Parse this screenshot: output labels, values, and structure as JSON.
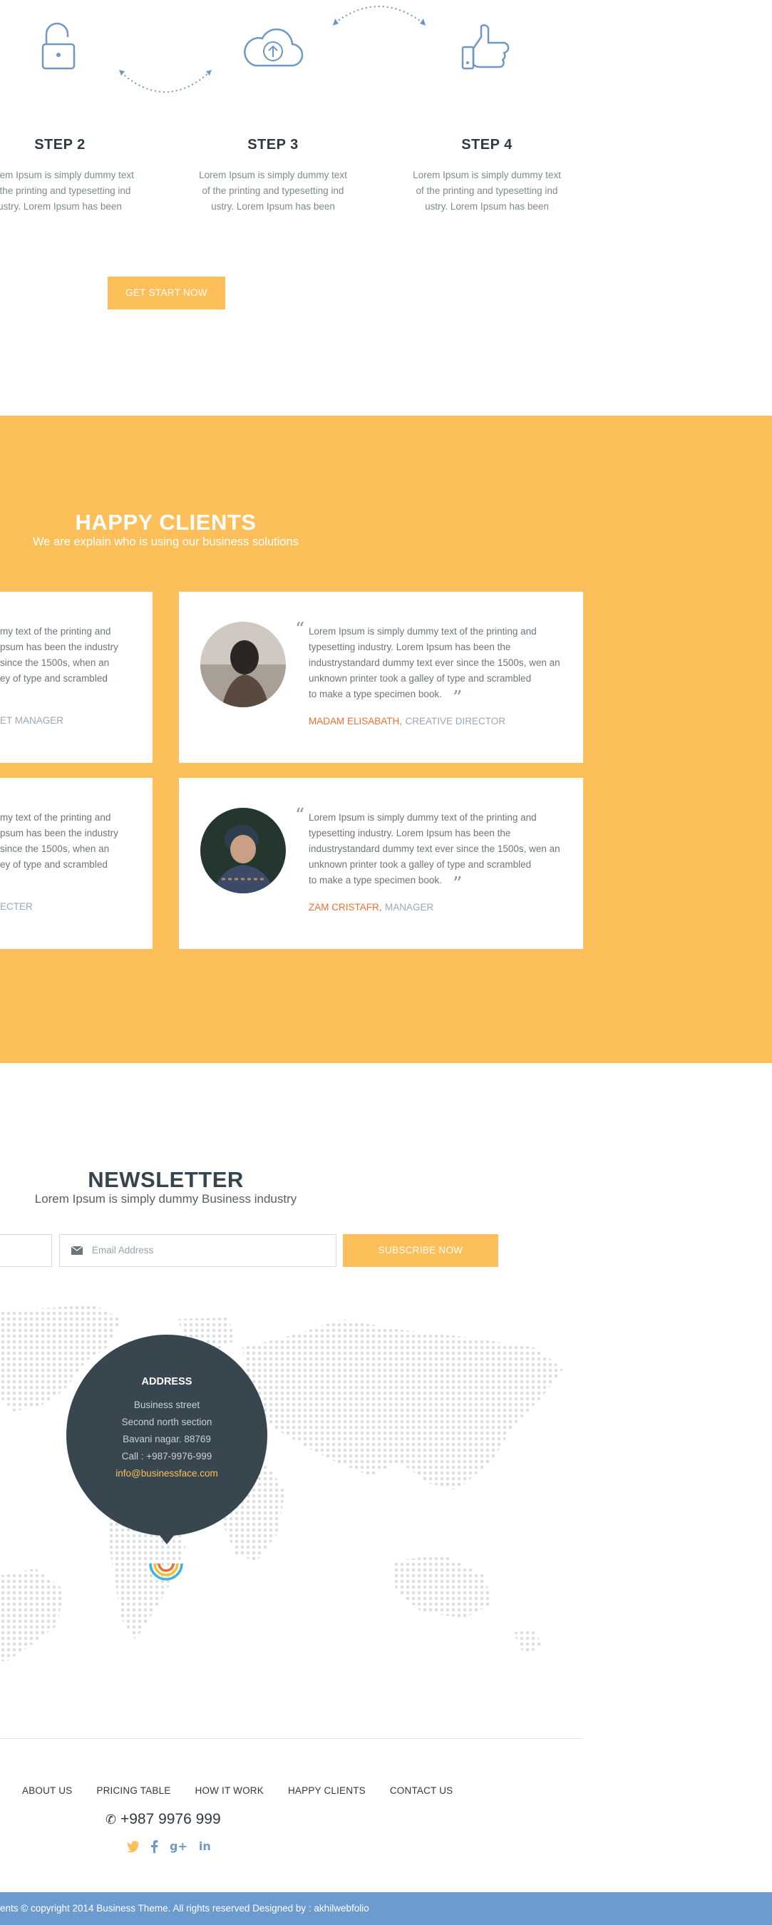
{
  "steps": [
    {
      "title": "STEP 2",
      "lines": [
        "Lorem Ipsum is simply dummy text",
        "of the printing and typesetting ind",
        "ustry. Lorem Ipsum has been"
      ]
    },
    {
      "title": "STEP 3",
      "lines": [
        "Lorem Ipsum is simply dummy text",
        "of the printing and typesetting ind",
        "ustry. Lorem Ipsum has been"
      ]
    },
    {
      "title": "STEP 4",
      "lines": [
        "Lorem Ipsum is simply dummy text",
        "of the printing and typesetting ind",
        "ustry. Lorem Ipsum has been"
      ]
    }
  ],
  "step_icons": [
    "unlock-icon",
    "cloud-upload-icon",
    "thumbs-up-icon"
  ],
  "cta_label": "GET START NOW",
  "clients": {
    "title": "HAPPY CLIENTS",
    "subtitle": "We are explain who is using our business solutions",
    "left_cards": [
      {
        "lines": [
          "my text of the printing and",
          "psum has been the industry",
          "since the 1500s, when an",
          "ey of type and scrambled"
        ],
        "role": "ET MANAGER"
      },
      {
        "lines": [
          "my text of the printing and",
          "psum has been the industry",
          "since the 1500s, when an",
          "ey of type and scrambled"
        ],
        "role": "ECTER"
      }
    ],
    "cards": [
      {
        "lines": [
          "Lorem Ipsum is simply dummy text of the printing and",
          "typesetting industry. Lorem Ipsum has been the",
          "industrystandard dummy text ever since the 1500s, wen an",
          "unknown printer took a galley of type and scrambled",
          "to make a type specimen book."
        ],
        "name": "MADAM ELISABATH,",
        "role": "CREATIVE DIRECTOR"
      },
      {
        "lines": [
          "Lorem Ipsum is simply dummy text of the printing and",
          "typesetting industry. Lorem Ipsum has been the",
          "industrystandard dummy text ever since the 1500s, wen an",
          "unknown printer took a galley of type and scrambled",
          "to make a type specimen book."
        ],
        "name": "ZAM CRISTAFR,",
        "role": "MANAGER"
      }
    ]
  },
  "newsletter": {
    "title": "NEWSLETTER",
    "subtitle": "Lorem Ipsum is simply dummy Business industry",
    "email_placeholder": "Email Address",
    "subscribe_label": "SUBSCRIBE NOW"
  },
  "address": {
    "title": "ADDRESS",
    "lines": [
      "Business street",
      "Second north section",
      "Bavani nagar. 88769",
      "Call : +987-9976-999"
    ],
    "email": "info@businessface.com"
  },
  "footer": {
    "links": [
      "ABOUT US",
      "PRICING TABLE",
      "HOW IT WORK",
      "HAPPY CLIENTS",
      "CONTACT US"
    ],
    "phone": "+987 9976 999",
    "social_icons": [
      "twitter-icon",
      "facebook-icon",
      "google-plus-icon",
      "linkedin-icon"
    ],
    "copyright": "ents © copyright 2014 Business Theme. All rights reserved Designed by : akhilwebfolio"
  },
  "colors": {
    "accent_orange": "#fdbf59",
    "dark_slate": "#38474f",
    "icon_blue": "#6f98c6",
    "name_orange": "#ee6f32",
    "footer_blue": "#6e9bcf"
  }
}
